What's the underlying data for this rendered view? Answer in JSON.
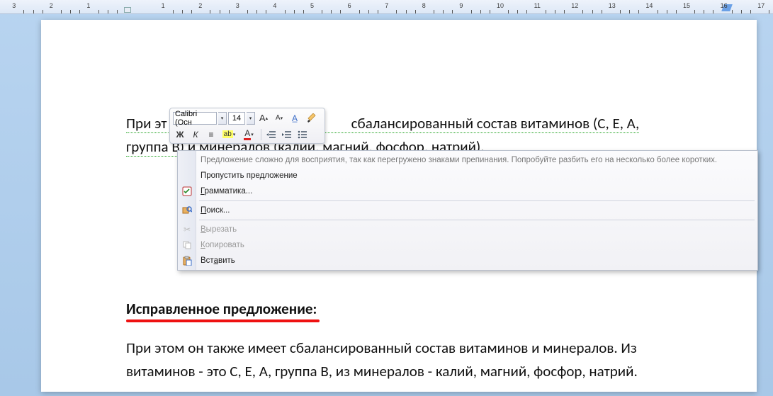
{
  "ruler": {
    "ticks": [
      -3,
      -2,
      -1,
      1,
      2,
      3,
      4,
      5,
      6,
      7,
      8,
      9,
      10,
      11,
      12,
      13,
      14,
      15,
      16,
      17
    ]
  },
  "document": {
    "para1_a": "При  эт",
    "para1_b": "  сбалансированный  состав  витаминов  (С,  Е,  А,",
    "para1_c": "группа В) и минералов (калий, магний, фосфор, натрий).",
    "heading2": "Исправленное предложение:",
    "para2": "При этом он также имеет сбалансированный состав витаминов и минералов. Из витаминов - это С, Е, А, группа В, из минералов - калий, магний, фосфор, натрий."
  },
  "mini_toolbar": {
    "font_name": "Calibri (Осн",
    "font_size": "14",
    "grow_font": "A",
    "shrink_font": "A",
    "bold": "Ж",
    "italic": "К",
    "center": "≡",
    "highlight": "ab",
    "font_color": "A"
  },
  "context_menu": {
    "suggestion": "Предложение сложно для восприятия, так как перегружено знаками препинания. Попробуйте разбить его на несколько более коротких.",
    "skip": "Пропустить предложение",
    "grammar": "Грамматика...",
    "search": "Поиск...",
    "cut": "Вырезать",
    "copy": "Копировать",
    "paste": "Вставить"
  }
}
